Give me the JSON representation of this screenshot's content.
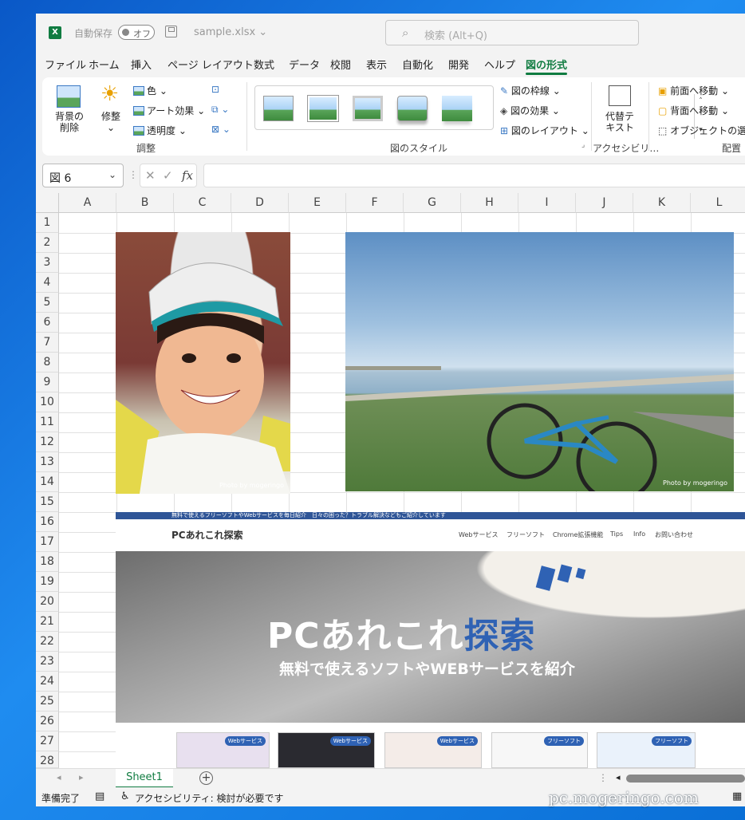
{
  "window": {
    "autosave_label": "自動保存",
    "autosave_state": "オフ",
    "filename": "sample.xlsx"
  },
  "search": {
    "placeholder": "検索 (Alt+Q)"
  },
  "menu": [
    "ファイル",
    "ホーム",
    "挿入",
    "ページ レイアウト",
    "数式",
    "データ",
    "校閲",
    "表示",
    "自動化",
    "開発",
    "ヘルプ",
    "図の形式"
  ],
  "active_menu": "図の形式",
  "ribbon": {
    "remove_bg": [
      "背景の",
      "削除"
    ],
    "corrections": "修整",
    "color": "色",
    "artistic": "アート効果",
    "transparency": "透明度",
    "adjust_group": "調整",
    "border": "図の枠線",
    "effects": "図の効果",
    "layout": "図のレイアウト",
    "styles_group": "図のスタイル",
    "alt_text": [
      "代替テ",
      "キスト"
    ],
    "accessibility_group": "アクセシビリ…",
    "bring_forward": "前面へ移動",
    "send_backward": "背面へ移動",
    "selection_pane": "オブジェクトの選択と",
    "arrange_group": "配置"
  },
  "namebox": "図 6",
  "columns": [
    "A",
    "B",
    "C",
    "D",
    "E",
    "F",
    "G",
    "H",
    "I",
    "J",
    "K",
    "L"
  ],
  "rows": [
    "1",
    "2",
    "3",
    "4",
    "5",
    "6",
    "7",
    "8",
    "9",
    "10",
    "11",
    "12",
    "13",
    "14",
    "15",
    "16",
    "17",
    "18",
    "19",
    "20",
    "21",
    "22",
    "23",
    "24",
    "25",
    "26",
    "27",
    "28"
  ],
  "photo_credit": "Photo by mogeringo",
  "site": {
    "topline": "無料で使えるフリーソフトやWebサービスを毎日紹介　日々の困った？トラブル解決などもご紹介しています",
    "name": "PCあれこれ探索",
    "nav": [
      "Webサービス",
      "フリーソフト",
      "Chrome拡張機能",
      "Tips",
      "Info",
      "お問い合わせ"
    ],
    "hero_title_a": "PCあれこれ",
    "hero_title_b": "探索",
    "hero_sub": "無料で使えるソフトやWEBサービスを紹介",
    "cards": [
      "Webサービス",
      "Webサービス",
      "Webサービス",
      "フリーソフト",
      "フリーソフト"
    ]
  },
  "sheet_tab": "Sheet1",
  "status": {
    "ready": "準備完了",
    "accessibility": "アクセシビリティ: 検討が必要です"
  },
  "watermark": "pc.mogeringo.com",
  "colors": {
    "excel_green": "#107c41",
    "site_navy": "#2f5597",
    "site_blue": "#2f62b4"
  }
}
